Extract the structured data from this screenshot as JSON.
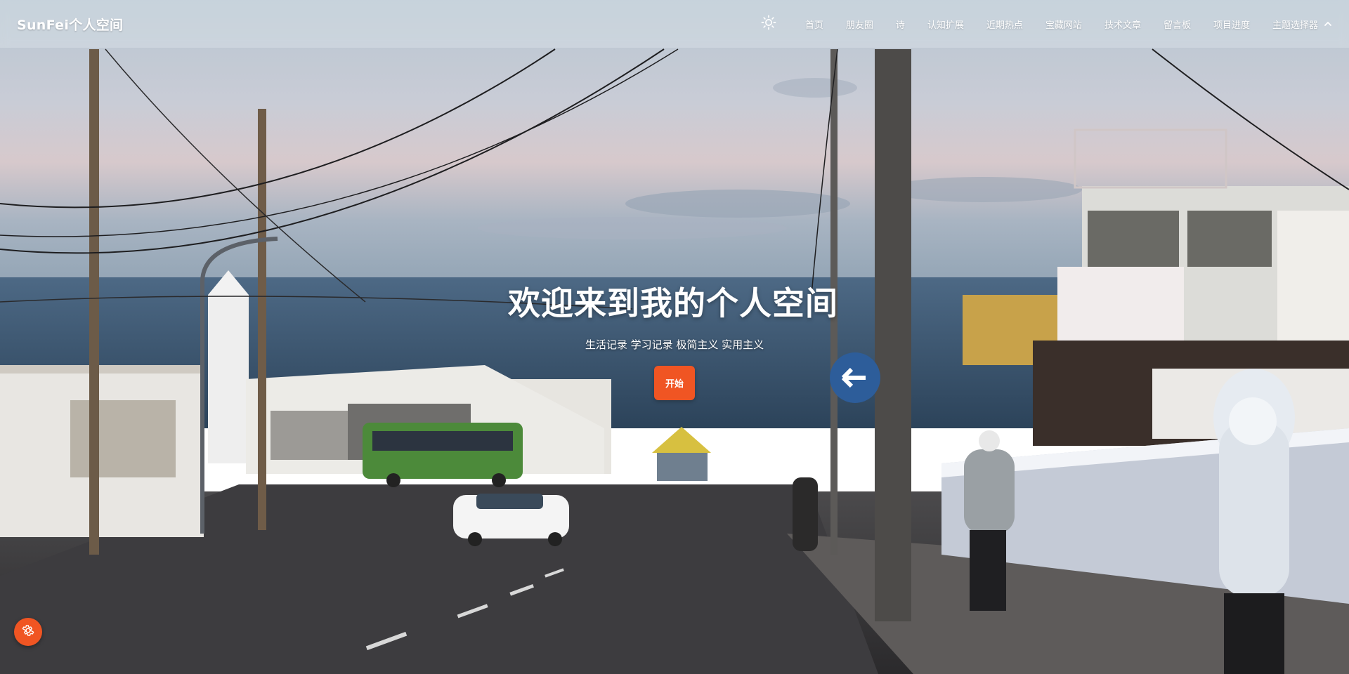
{
  "brand": {
    "name": "SunFei个人空间"
  },
  "nav": {
    "theme_icon": "sun-icon",
    "items": [
      {
        "label": "首页"
      },
      {
        "label": "朋友圈"
      },
      {
        "label": "诗"
      },
      {
        "label": "认知扩展"
      },
      {
        "label": "近期热点"
      },
      {
        "label": "宝藏网站"
      },
      {
        "label": "技术文章"
      },
      {
        "label": "留言板"
      },
      {
        "label": "项目进度"
      }
    ],
    "theme_selector": {
      "label": "主题选择器",
      "icon": "chevron-up-icon"
    }
  },
  "hero": {
    "title": "欢迎来到我的个人空间",
    "subtitle": "生活记录 学习记录 极简主义 实用主义",
    "button_label": "开始"
  },
  "fab": {
    "icon": "gear-icon"
  },
  "colors": {
    "accent": "#f05523",
    "nav_text": "#ffffff"
  }
}
